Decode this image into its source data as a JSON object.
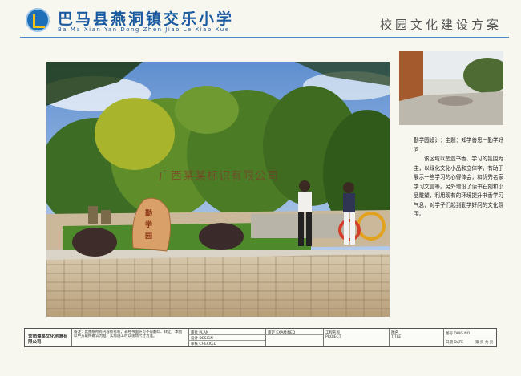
{
  "header": {
    "school_name": "巴马县燕洞镇交乐小学",
    "school_pinyin": "Ba Ma Xian Yan Dong Zhen Jiao Le Xiao Xue",
    "plan_title": "校园文化建设方案"
  },
  "render": {
    "stone_text": "勤学园",
    "watermark": "广西某某标识有限公司"
  },
  "description": {
    "heading": "勤学园设计：主题：知学善思－勤学好问",
    "body": "该区域以塑造书香、学习的氛围为主，以绿化文化小品和立体字，有助于展示一些学习的心得体会，和优秀名家学习文言等。另外增设了读书石刻和小品雕塑，利用现有的环境提升书香学习气息，对学子们起到勤学好问的文化氛围。"
  },
  "title_block": {
    "company": "营销谭某文化创意有限公司",
    "notes": "备注：此图纸所有内容所有权，非经书面许可不得翻印、转让。本图以甲方最终确认为准，实际施工时以现场尺寸为准。",
    "plan_label": "审批 PLAN",
    "design_label": "设计 DESIGN",
    "checked_label": "审核 CHECKED",
    "examined_label": "审定 EXAMINED",
    "project_label": "工程名称 PROJECT",
    "title_label": "图名 TITLE",
    "dwg_label": "图号 DWG.NO",
    "date_label": "日期 DATE",
    "page_label": "第  页 共  页"
  }
}
